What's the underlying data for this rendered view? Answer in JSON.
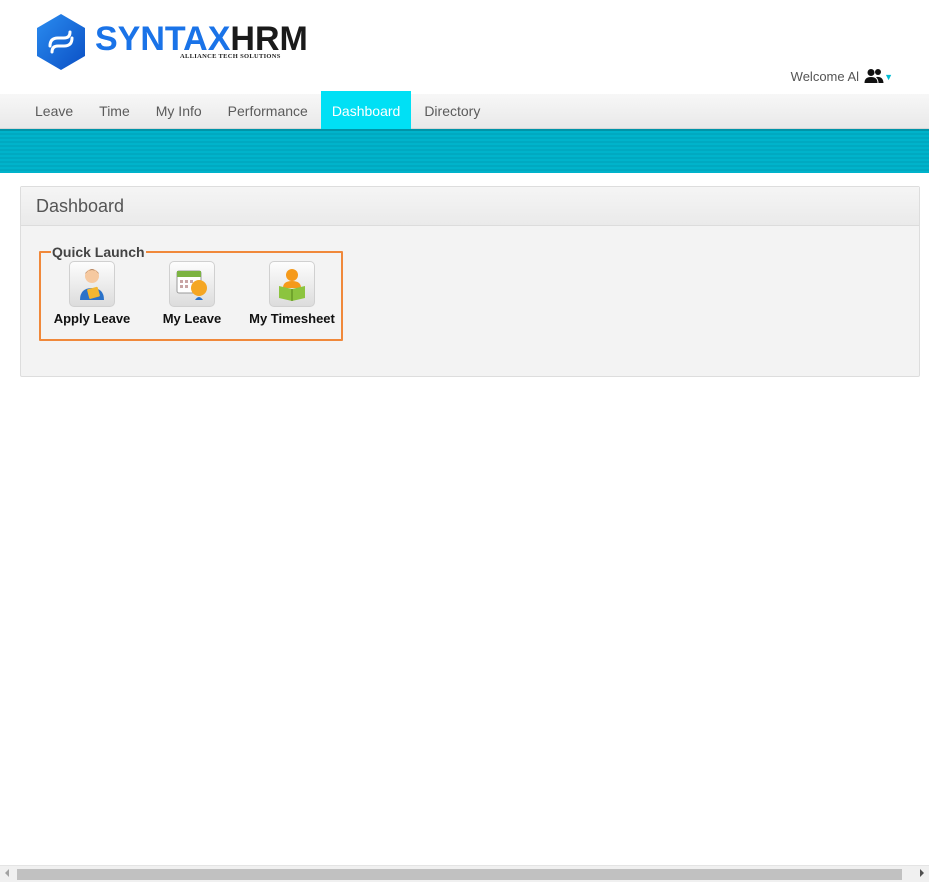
{
  "brand": {
    "name_part1": "SYNTAX",
    "name_part2": "HRM",
    "tagline": "ALLIANCE TECH SOLUTIONS",
    "primary_color": "#1a73e8"
  },
  "user": {
    "welcome_text": "Welcome Al",
    "icon": "users-icon",
    "dropdown_icon": "caret-down-icon"
  },
  "menu": {
    "items": [
      {
        "label": "Leave"
      },
      {
        "label": "Time"
      },
      {
        "label": "My Info"
      },
      {
        "label": "Performance"
      },
      {
        "label": "Dashboard",
        "active": true
      },
      {
        "label": "Directory"
      }
    ],
    "active_color": "#00e0f5"
  },
  "dashboard": {
    "title": "Dashboard",
    "quick_launch": {
      "legend": "Quick Launch",
      "border_color": "#f0883a",
      "items": [
        {
          "label": "Apply Leave",
          "icon": "apply-leave-icon"
        },
        {
          "label": "My Leave",
          "icon": "calendar-leave-icon"
        },
        {
          "label": "My Timesheet",
          "icon": "timesheet-icon"
        }
      ]
    }
  }
}
